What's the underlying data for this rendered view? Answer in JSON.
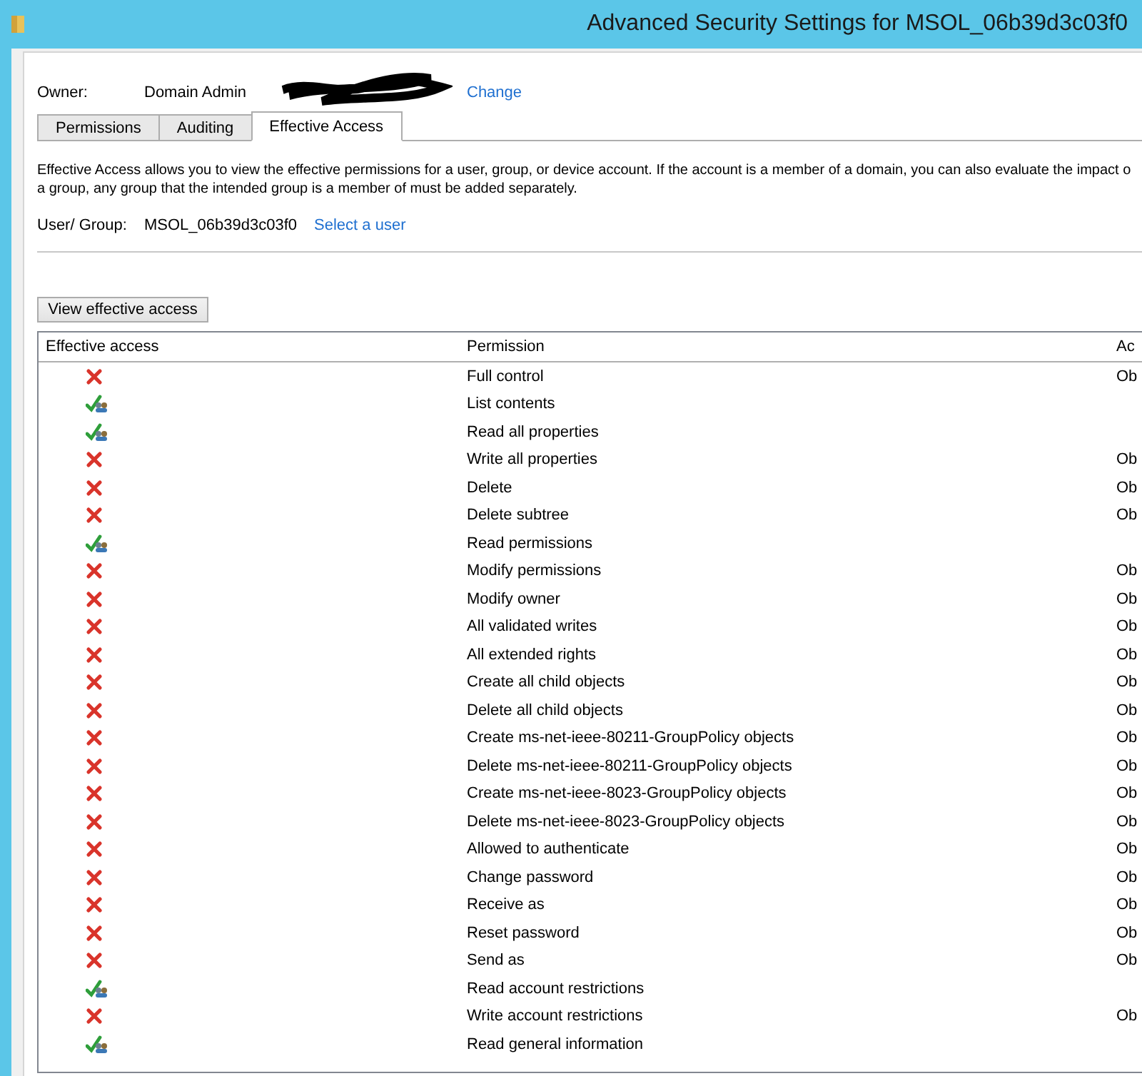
{
  "window": {
    "title": "Advanced Security Settings for MSOL_06b39d3c03f0"
  },
  "owner": {
    "label": "Owner:",
    "value": "Domain Admin",
    "link": "Change"
  },
  "tabs": [
    {
      "label": "Permissions",
      "selected": false
    },
    {
      "label": "Auditing",
      "selected": false
    },
    {
      "label": "Effective Access",
      "selected": true
    }
  ],
  "description": [
    "Effective Access allows you to view the effective permissions for a user, group, or device account. If the account is a member of a domain, you can also evaluate the impact o",
    "a group, any group that the intended group is a member of must be added separately."
  ],
  "user_group": {
    "label": "User/ Group:",
    "value": "MSOL_06b39d3c03f0",
    "link": "Select a user"
  },
  "view_button": "View effective access",
  "table": {
    "columns": [
      "Effective access",
      "Permission",
      "Ac"
    ],
    "rows": [
      {
        "allowed": false,
        "permission": "Full control",
        "access": "Ob"
      },
      {
        "allowed": true,
        "permission": "List contents"
      },
      {
        "allowed": true,
        "permission": "Read all properties"
      },
      {
        "allowed": false,
        "permission": "Write all properties",
        "access": "Ob"
      },
      {
        "allowed": false,
        "permission": "Delete",
        "access": "Ob"
      },
      {
        "allowed": false,
        "permission": "Delete subtree",
        "access": "Ob"
      },
      {
        "allowed": true,
        "permission": "Read permissions"
      },
      {
        "allowed": false,
        "permission": "Modify permissions",
        "access": "Ob"
      },
      {
        "allowed": false,
        "permission": "Modify owner",
        "access": "Ob"
      },
      {
        "allowed": false,
        "permission": "All validated writes",
        "access": "Ob"
      },
      {
        "allowed": false,
        "permission": "All extended rights",
        "access": "Ob"
      },
      {
        "allowed": false,
        "permission": "Create all child objects",
        "access": "Ob"
      },
      {
        "allowed": false,
        "permission": "Delete all child objects",
        "access": "Ob"
      },
      {
        "allowed": false,
        "permission": "Create ms-net-ieee-80211-GroupPolicy objects",
        "access": "Ob"
      },
      {
        "allowed": false,
        "permission": "Delete ms-net-ieee-80211-GroupPolicy objects",
        "access": "Ob"
      },
      {
        "allowed": false,
        "permission": "Create ms-net-ieee-8023-GroupPolicy objects",
        "access": "Ob"
      },
      {
        "allowed": false,
        "permission": "Delete ms-net-ieee-8023-GroupPolicy objects",
        "access": "Ob"
      },
      {
        "allowed": false,
        "permission": "Allowed to authenticate",
        "access": "Ob"
      },
      {
        "allowed": false,
        "permission": "Change password",
        "access": "Ob"
      },
      {
        "allowed": false,
        "permission": "Receive as",
        "access": "Ob"
      },
      {
        "allowed": false,
        "permission": "Reset password",
        "access": "Ob"
      },
      {
        "allowed": false,
        "permission": "Send as",
        "access": "Ob"
      },
      {
        "allowed": true,
        "permission": "Read account restrictions"
      },
      {
        "allowed": false,
        "permission": "Write account restrictions",
        "access": "Ob"
      },
      {
        "allowed": true,
        "permission": "Read general information"
      }
    ]
  }
}
